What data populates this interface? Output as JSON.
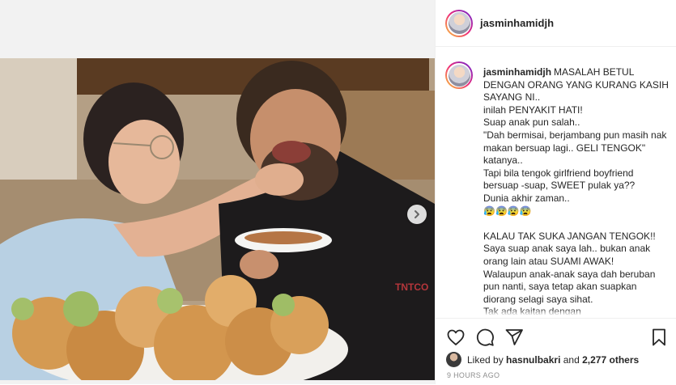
{
  "post": {
    "username": "jasminhamidjh"
  },
  "caption": {
    "username": "jasminhamidjh",
    "first_line": "MASALAH BETUL DENGAN ORANG YANG KURANG KASIH SAYANG NI..",
    "lines": [
      "inilah PENYAKIT HATI!",
      "Suap anak pun salah..",
      "\"Dah bermisai, berjambang pun masih nak makan bersuap lagi.. GELI TENGOK\" katanya..",
      "Tapi bila tengok girlfriend boyfriend bersuap -suap, SWEET pulak ya??",
      "Dunia akhir zaman..",
      "😰😰😰😰",
      "",
      "KALAU TAK SUKA JANGAN TENGOK!!",
      "Saya suap anak saya lah.. bukan anak orang lain atau SUAMI AWAK!",
      "Walaupun anak-anak saya dah beruban pun nanti, saya tetap akan suapkan diorang selagi saya sihat.",
      "Tak ada kaitan dengan"
    ]
  },
  "likes": {
    "prefix": "Liked by",
    "user": "hasnulbakri",
    "connector": "and",
    "others": "2,277 others"
  },
  "timestamp": "9 HOURS AGO",
  "photo": {
    "shirt_text": "TNTCO"
  },
  "icons": {
    "like": "heart-icon",
    "comment": "comment-icon",
    "share": "paper-plane-icon",
    "save": "bookmark-icon",
    "next": "chevron-right-icon"
  }
}
